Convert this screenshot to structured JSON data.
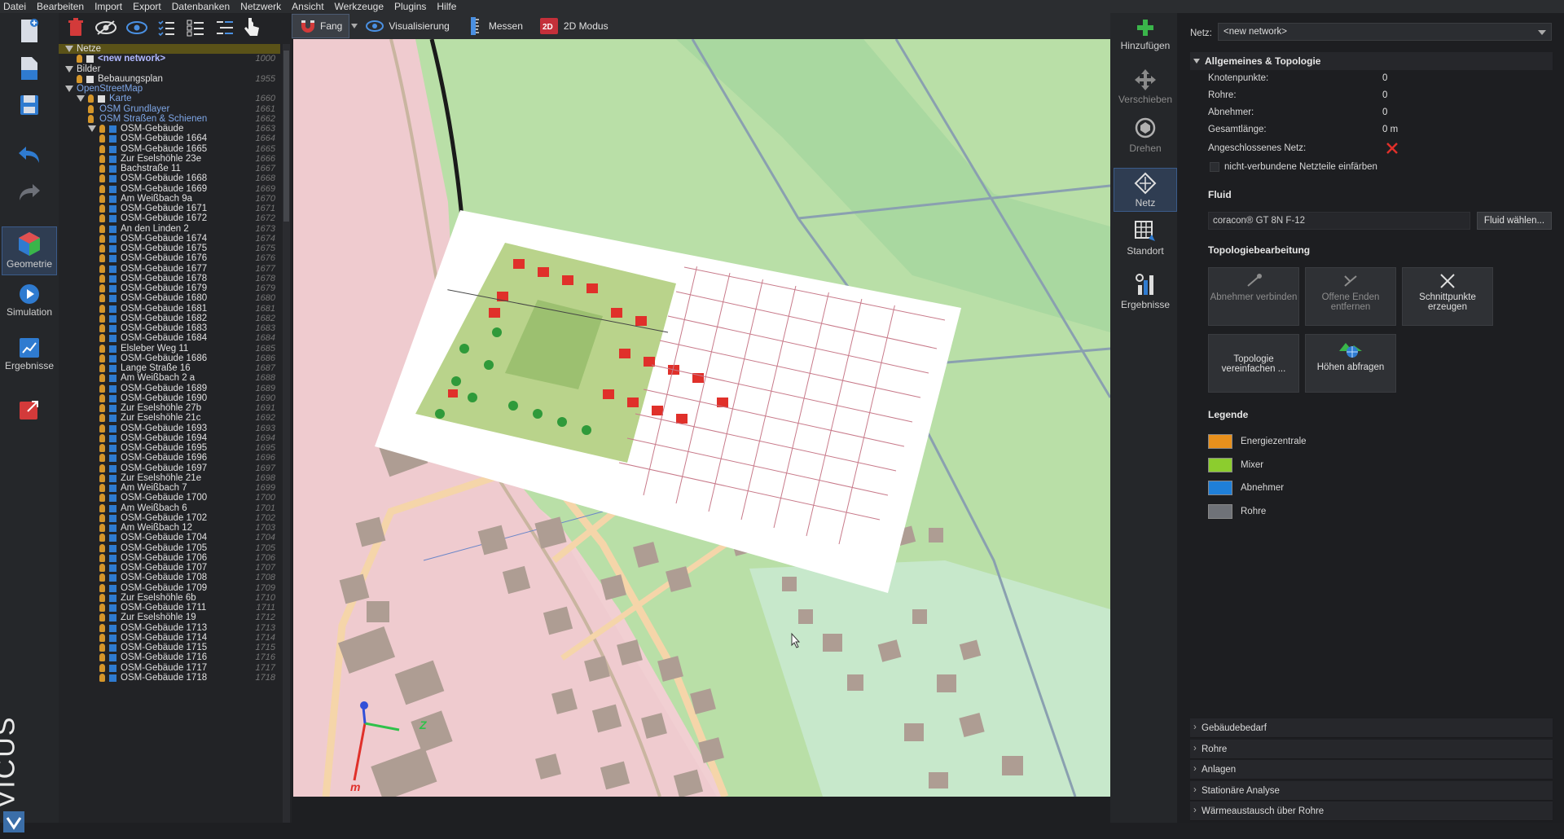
{
  "menu": [
    "Datei",
    "Bearbeiten",
    "Import",
    "Export",
    "Datenbanken",
    "Netzwerk",
    "Ansicht",
    "Werkzeuge",
    "Plugins",
    "Hilfe"
  ],
  "left_tools": {
    "geometrie": "Geometrie",
    "simulation": "Simulation",
    "ergebnisse": "Ergebnisse",
    "brand": "VICUS"
  },
  "view_tools": {
    "fang": "Fang",
    "visualisierung": "Visualisierung",
    "messen": "Messen",
    "modus2d": "2D Modus"
  },
  "tree": {
    "items": [
      {
        "label": "Netze",
        "num": "",
        "indent": 0,
        "kind": "group",
        "hl": true
      },
      {
        "label": "<new network>",
        "num": "1000",
        "indent": 1,
        "kind": "network"
      },
      {
        "label": "Bilder",
        "num": "",
        "indent": 0,
        "kind": "group"
      },
      {
        "label": "Bebauungsplan",
        "num": "1955",
        "indent": 1,
        "kind": "image"
      },
      {
        "label": "OpenStreetMap",
        "num": "",
        "indent": 0,
        "kind": "group",
        "link": true
      },
      {
        "label": "Karte",
        "num": "1660",
        "indent": 1,
        "kind": "map",
        "link": true
      },
      {
        "label": "OSM Grundlayer",
        "num": "1661",
        "indent": 2,
        "kind": "layer",
        "link": true
      },
      {
        "label": "OSM Straßen & Schienen",
        "num": "1662",
        "indent": 2,
        "kind": "layer",
        "link": true
      },
      {
        "label": "OSM-Gebäude",
        "num": "1663",
        "indent": 2,
        "kind": "folder"
      },
      {
        "label": "OSM-Gebäude 1664",
        "num": "1664",
        "indent": 3,
        "kind": "building"
      },
      {
        "label": "OSM-Gebäude 1665",
        "num": "1665",
        "indent": 3,
        "kind": "building"
      },
      {
        "label": "Zur Eselshöhle 23e",
        "num": "1666",
        "indent": 3,
        "kind": "building"
      },
      {
        "label": "Bachstraße 11",
        "num": "1667",
        "indent": 3,
        "kind": "building"
      },
      {
        "label": "OSM-Gebäude 1668",
        "num": "1668",
        "indent": 3,
        "kind": "building"
      },
      {
        "label": "OSM-Gebäude 1669",
        "num": "1669",
        "indent": 3,
        "kind": "building"
      },
      {
        "label": "Am Weißbach 9a",
        "num": "1670",
        "indent": 3,
        "kind": "building"
      },
      {
        "label": "OSM-Gebäude 1671",
        "num": "1671",
        "indent": 3,
        "kind": "building"
      },
      {
        "label": "OSM-Gebäude 1672",
        "num": "1672",
        "indent": 3,
        "kind": "building"
      },
      {
        "label": "An den Linden 2",
        "num": "1673",
        "indent": 3,
        "kind": "building"
      },
      {
        "label": "OSM-Gebäude 1674",
        "num": "1674",
        "indent": 3,
        "kind": "building"
      },
      {
        "label": "OSM-Gebäude 1675",
        "num": "1675",
        "indent": 3,
        "kind": "building"
      },
      {
        "label": "OSM-Gebäude 1676",
        "num": "1676",
        "indent": 3,
        "kind": "building"
      },
      {
        "label": "OSM-Gebäude 1677",
        "num": "1677",
        "indent": 3,
        "kind": "building"
      },
      {
        "label": "OSM-Gebäude 1678",
        "num": "1678",
        "indent": 3,
        "kind": "building"
      },
      {
        "label": "OSM-Gebäude 1679",
        "num": "1679",
        "indent": 3,
        "kind": "building"
      },
      {
        "label": "OSM-Gebäude 1680",
        "num": "1680",
        "indent": 3,
        "kind": "building"
      },
      {
        "label": "OSM-Gebäude 1681",
        "num": "1681",
        "indent": 3,
        "kind": "building"
      },
      {
        "label": "OSM-Gebäude 1682",
        "num": "1682",
        "indent": 3,
        "kind": "building"
      },
      {
        "label": "OSM-Gebäude 1683",
        "num": "1683",
        "indent": 3,
        "kind": "building"
      },
      {
        "label": "OSM-Gebäude 1684",
        "num": "1684",
        "indent": 3,
        "kind": "building"
      },
      {
        "label": "Elsleber Weg 11",
        "num": "1685",
        "indent": 3,
        "kind": "building"
      },
      {
        "label": "OSM-Gebäude 1686",
        "num": "1686",
        "indent": 3,
        "kind": "building"
      },
      {
        "label": "Lange Straße 16",
        "num": "1687",
        "indent": 3,
        "kind": "building"
      },
      {
        "label": "Am Weißbach 2 a",
        "num": "1688",
        "indent": 3,
        "kind": "building"
      },
      {
        "label": "OSM-Gebäude 1689",
        "num": "1689",
        "indent": 3,
        "kind": "building"
      },
      {
        "label": "OSM-Gebäude 1690",
        "num": "1690",
        "indent": 3,
        "kind": "building"
      },
      {
        "label": "Zur Eselshöhle 27b",
        "num": "1691",
        "indent": 3,
        "kind": "building"
      },
      {
        "label": "Zur Eselshöhle 21c",
        "num": "1692",
        "indent": 3,
        "kind": "building"
      },
      {
        "label": "OSM-Gebäude 1693",
        "num": "1693",
        "indent": 3,
        "kind": "building"
      },
      {
        "label": "OSM-Gebäude 1694",
        "num": "1694",
        "indent": 3,
        "kind": "building"
      },
      {
        "label": "OSM-Gebäude 1695",
        "num": "1695",
        "indent": 3,
        "kind": "building"
      },
      {
        "label": "OSM-Gebäude 1696",
        "num": "1696",
        "indent": 3,
        "kind": "building"
      },
      {
        "label": "OSM-Gebäude 1697",
        "num": "1697",
        "indent": 3,
        "kind": "building"
      },
      {
        "label": "Zur Eselshöhle 21e",
        "num": "1698",
        "indent": 3,
        "kind": "building"
      },
      {
        "label": "Am Weißbach 7",
        "num": "1699",
        "indent": 3,
        "kind": "building"
      },
      {
        "label": "OSM-Gebäude 1700",
        "num": "1700",
        "indent": 3,
        "kind": "building"
      },
      {
        "label": "Am Weißbach 6",
        "num": "1701",
        "indent": 3,
        "kind": "building"
      },
      {
        "label": "OSM-Gebäude 1702",
        "num": "1702",
        "indent": 3,
        "kind": "building"
      },
      {
        "label": "Am Weißbach 12",
        "num": "1703",
        "indent": 3,
        "kind": "building"
      },
      {
        "label": "OSM-Gebäude 1704",
        "num": "1704",
        "indent": 3,
        "kind": "building"
      },
      {
        "label": "OSM-Gebäude 1705",
        "num": "1705",
        "indent": 3,
        "kind": "building"
      },
      {
        "label": "OSM-Gebäude 1706",
        "num": "1706",
        "indent": 3,
        "kind": "building"
      },
      {
        "label": "OSM-Gebäude 1707",
        "num": "1707",
        "indent": 3,
        "kind": "building"
      },
      {
        "label": "OSM-Gebäude 1708",
        "num": "1708",
        "indent": 3,
        "kind": "building"
      },
      {
        "label": "OSM-Gebäude 1709",
        "num": "1709",
        "indent": 3,
        "kind": "building"
      },
      {
        "label": "Zur Eselshöhle 6b",
        "num": "1710",
        "indent": 3,
        "kind": "building"
      },
      {
        "label": "OSM-Gebäude 1711",
        "num": "1711",
        "indent": 3,
        "kind": "building"
      },
      {
        "label": "Zur Eselshöhle 19",
        "num": "1712",
        "indent": 3,
        "kind": "building"
      },
      {
        "label": "OSM-Gebäude 1713",
        "num": "1713",
        "indent": 3,
        "kind": "building"
      },
      {
        "label": "OSM-Gebäude 1714",
        "num": "1714",
        "indent": 3,
        "kind": "building"
      },
      {
        "label": "OSM-Gebäude 1715",
        "num": "1715",
        "indent": 3,
        "kind": "building"
      },
      {
        "label": "OSM-Gebäude 1716",
        "num": "1716",
        "indent": 3,
        "kind": "building"
      },
      {
        "label": "OSM-Gebäude 1717",
        "num": "1717",
        "indent": 3,
        "kind": "building"
      },
      {
        "label": "OSM-Gebäude 1718",
        "num": "1718",
        "indent": 3,
        "kind": "building"
      }
    ]
  },
  "right_tools": {
    "hinzufuegen": "Hinzufügen",
    "verschieben": "Verschieben",
    "drehen": "Drehen",
    "netz": "Netz",
    "standort": "Standort",
    "ergebnisse": "Ergebnisse"
  },
  "axis": {
    "x": "Z",
    "y": "m"
  },
  "props": {
    "netz_label": "Netz:",
    "netz_value": "<new network>",
    "section_general": "Allgemeines & Topologie",
    "knoten_label": "Knotenpunkte:",
    "knoten_value": "0",
    "rohre_label": "Rohre:",
    "rohre_value": "0",
    "abnehmer_label": "Abnehmer:",
    "abnehmer_value": "0",
    "laenge_label": "Gesamtlänge:",
    "laenge_value": "0 m",
    "angeschlossen_label": "Angeschlossenes Netz:",
    "nicht_verbunden_label": "nicht-verbundene Netzteile einfärben",
    "fluid_head": "Fluid",
    "fluid_value": "coracon® GT 8N F-12",
    "fluid_button": "Fluid wählen...",
    "topo_head": "Topologiebearbeitung",
    "btn_abnehmer_verbinden": "Abnehmer verbinden",
    "btn_offene_enden": "Offene Enden entfernen",
    "btn_schnittpunkte": "Schnittpunkte erzeugen",
    "btn_topologie": "Topologie vereinfachen ...",
    "btn_hoehen": "Höhen abfragen",
    "legend_head": "Legende",
    "legend": [
      {
        "label": "Energiezentrale",
        "color": "#e8901c"
      },
      {
        "label": "Mixer",
        "color": "#8ccd2e"
      },
      {
        "label": "Abnehmer",
        "color": "#1f7fd8"
      },
      {
        "label": "Rohre",
        "color": "#6f7278"
      }
    ],
    "sections": [
      "Gebäudebedarf",
      "Rohre",
      "Anlagen",
      "Stationäre Analyse",
      "Wärmeaustausch über Rohre"
    ]
  },
  "colors": {
    "accent": "#2f7bd0",
    "highlight": "#5a5218",
    "error_x": "#e0302a"
  }
}
